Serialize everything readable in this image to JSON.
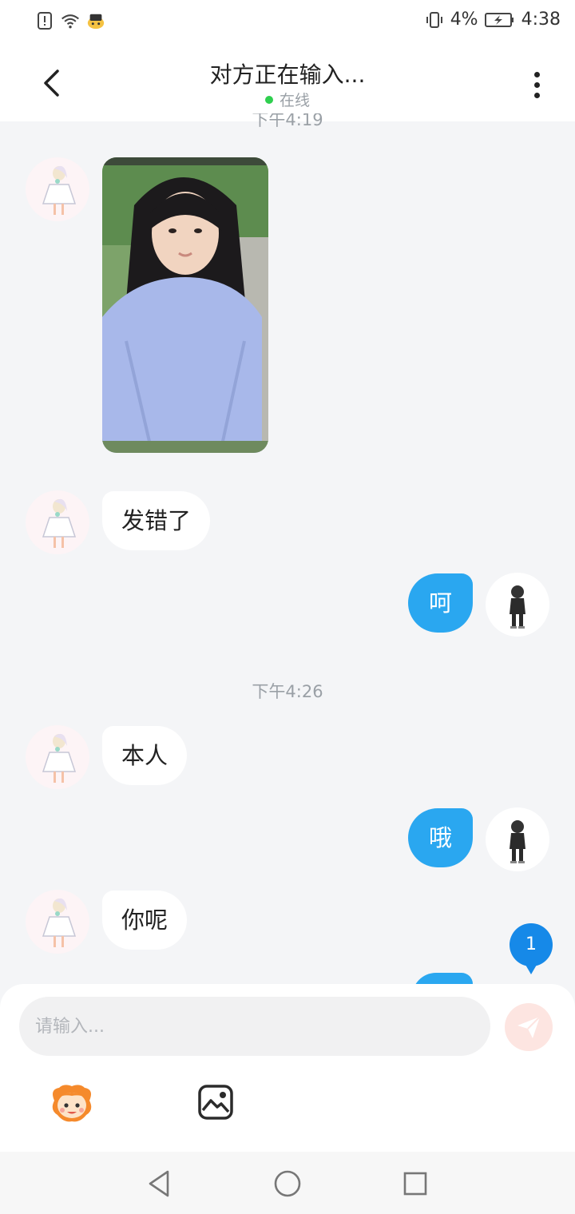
{
  "status_bar": {
    "battery_percent": "4%",
    "time": "4:38"
  },
  "header": {
    "title": "对方正在输入...",
    "status": "在线"
  },
  "chat": {
    "timestamp_top": "下午4:19",
    "messages": [
      {
        "side": "left",
        "type": "image"
      },
      {
        "side": "left",
        "type": "text",
        "text": "发错了"
      },
      {
        "side": "right",
        "type": "text",
        "text": "呵"
      },
      {
        "side": "center",
        "type": "timestamp",
        "text": "下午4:26"
      },
      {
        "side": "left",
        "type": "text",
        "text": "本人"
      },
      {
        "side": "right",
        "type": "text",
        "text": "哦"
      },
      {
        "side": "left",
        "type": "text",
        "text": "你呢"
      }
    ],
    "unread_badge": "1"
  },
  "input": {
    "placeholder": "请输入..."
  },
  "icons": {
    "emoji": "emoji-face-icon",
    "image": "image-icon",
    "send": "send-paper-plane-icon"
  },
  "colors": {
    "accent": "#2aa7f0",
    "badge": "#1689e8",
    "online": "#2fcf4f",
    "background": "#f4f5f7"
  }
}
